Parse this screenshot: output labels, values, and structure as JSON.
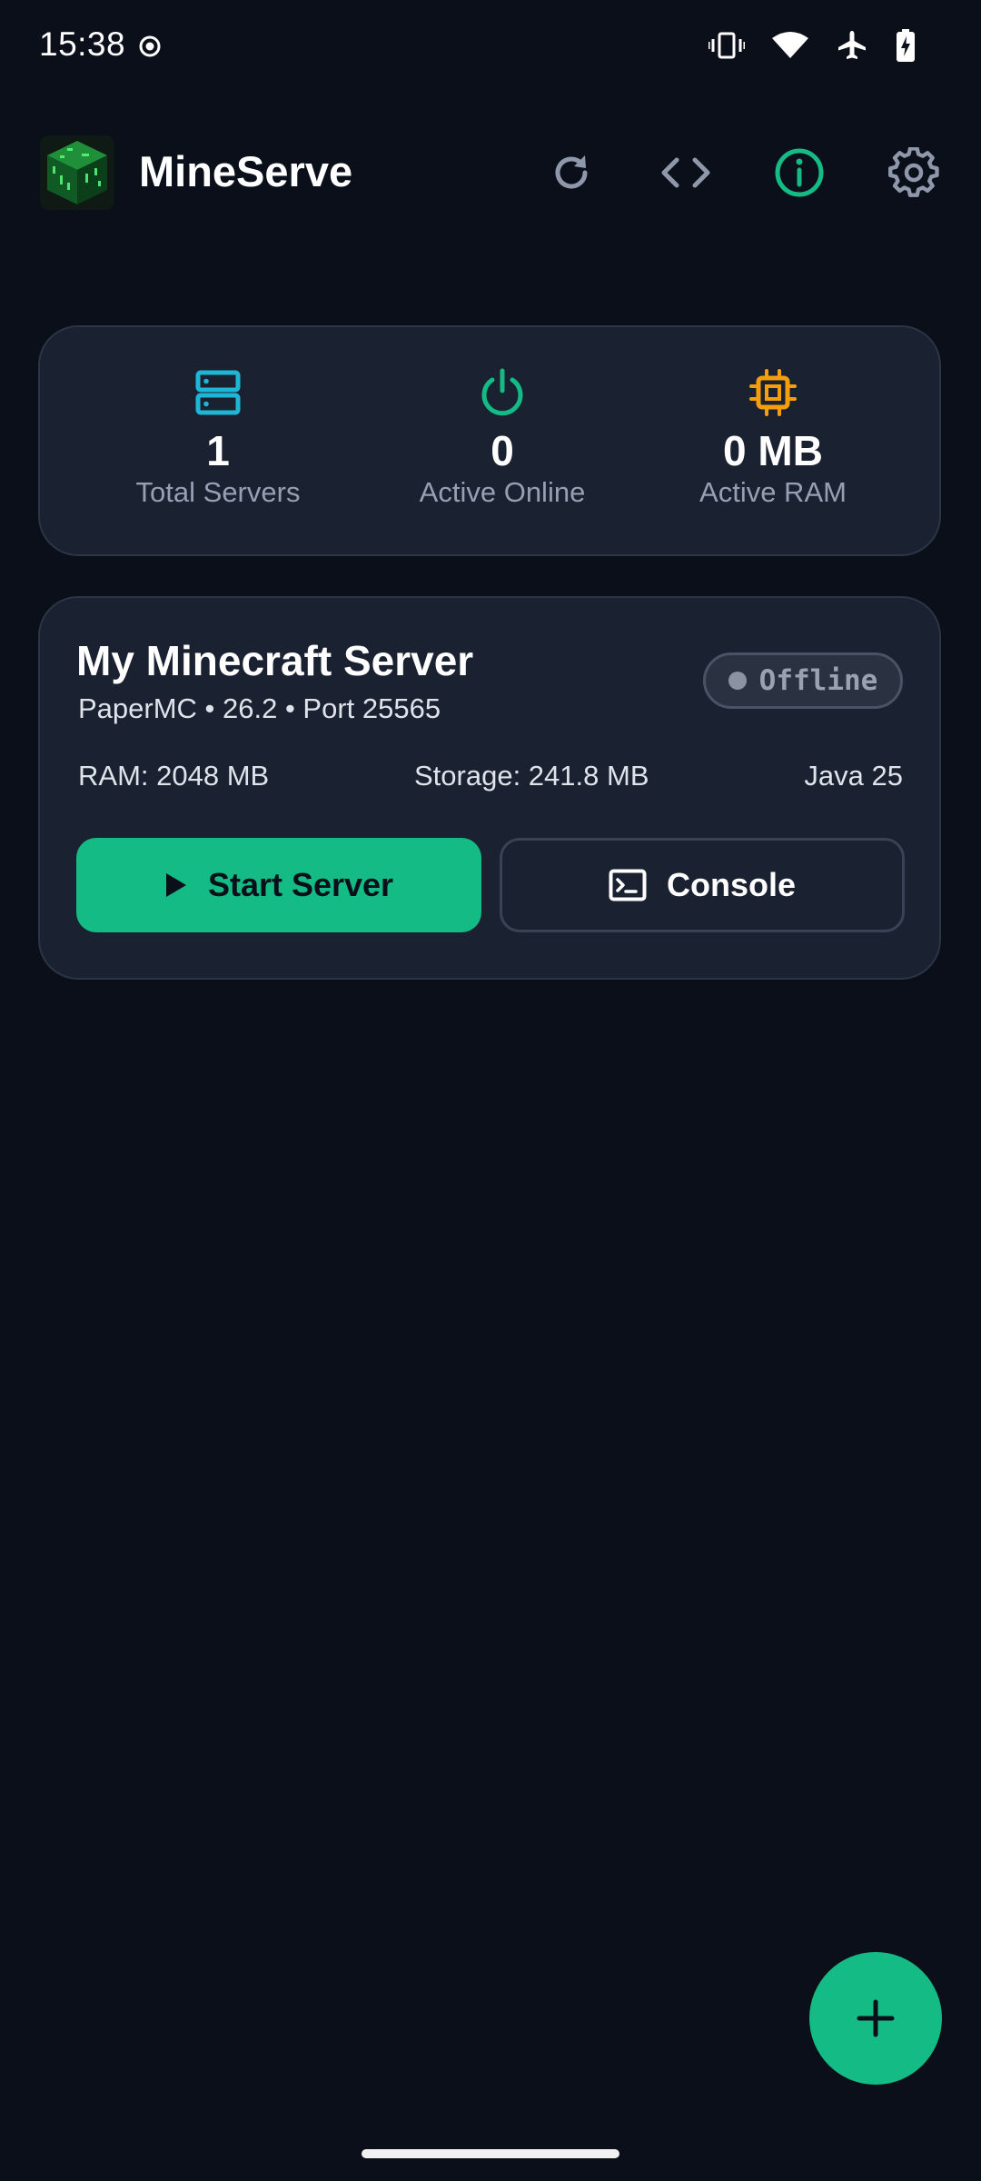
{
  "status_bar": {
    "time": "15:38",
    "icons": [
      "record-icon",
      "vibrate-icon",
      "wifi-icon",
      "airplane-icon",
      "battery-charging-icon"
    ]
  },
  "header": {
    "title": "MineServe",
    "actions": [
      "refresh-icon",
      "code-icon",
      "info-icon",
      "settings-icon"
    ]
  },
  "stats": {
    "total_servers": {
      "value": "1",
      "label": "Total Servers",
      "icon": "server-icon",
      "color": "#1fb6d6"
    },
    "active_online": {
      "value": "0",
      "label": "Active Online",
      "icon": "power-icon",
      "color": "#14bb85"
    },
    "active_ram": {
      "value": "0 MB",
      "label": "Active RAM",
      "icon": "cpu-chip-icon",
      "color": "#f59e0b"
    }
  },
  "server": {
    "name": "My Minecraft Server",
    "meta": "PaperMC • 26.2 • Port 25565",
    "status": "Offline",
    "ram": "RAM: 2048 MB",
    "storage": "Storage: 241.8 MB",
    "java": "Java 25",
    "start_label": "Start Server",
    "console_label": "Console"
  },
  "colors": {
    "background": "#0b0f19",
    "card": "#1a2130",
    "accent": "#14bb85"
  }
}
